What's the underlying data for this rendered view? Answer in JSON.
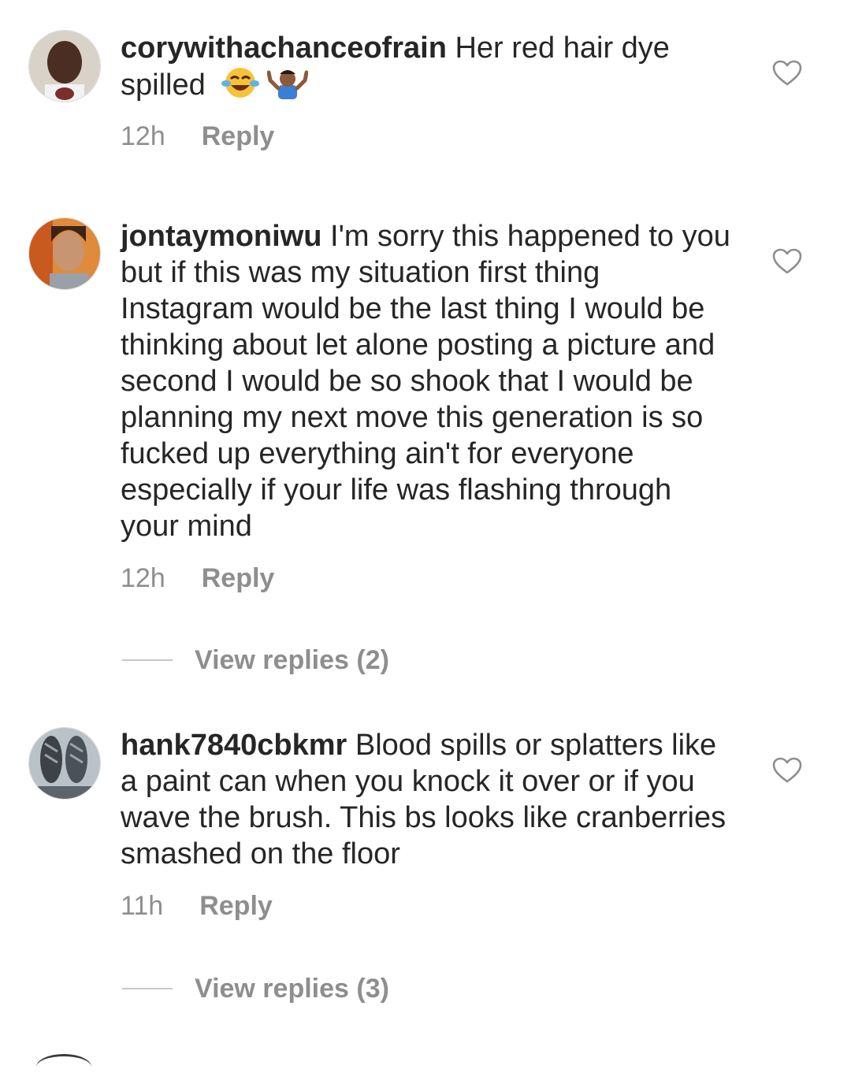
{
  "comments": [
    {
      "username": "corywithachanceofrain",
      "text": " Her red hair dye spilled",
      "emojis": [
        "face-with-tears-of-joy-emoji",
        "person-shrugging-emoji"
      ],
      "time": "12h",
      "reply_label": "Reply"
    },
    {
      "username": "jontaymoniwu",
      "text": " I'm sorry this happened to you but if this was my situation first thing Instagram would be the last thing I would be thinking about let alone posting a picture and second I would be so shook that I would be planning my next move this generation is so fucked up everything ain't for everyone especially if your life was flashing through your mind",
      "time": "12h",
      "reply_label": "Reply",
      "view_replies": "View replies (2)"
    },
    {
      "username": "hank7840cbkmr",
      "text": " Blood spills or splatters like a paint can when you knock it over or if you wave the brush. This bs looks like cranberries smashed on the floor",
      "time": "11h",
      "reply_label": "Reply",
      "view_replies": "View replies (3)"
    }
  ],
  "partial_next_comment": {
    "username": "",
    "text": ""
  },
  "colors": {
    "text": "#262626",
    "meta": "#8e8e8e",
    "divider": "#c7c7c7"
  },
  "icons": {
    "like": "heart-outline-icon"
  }
}
